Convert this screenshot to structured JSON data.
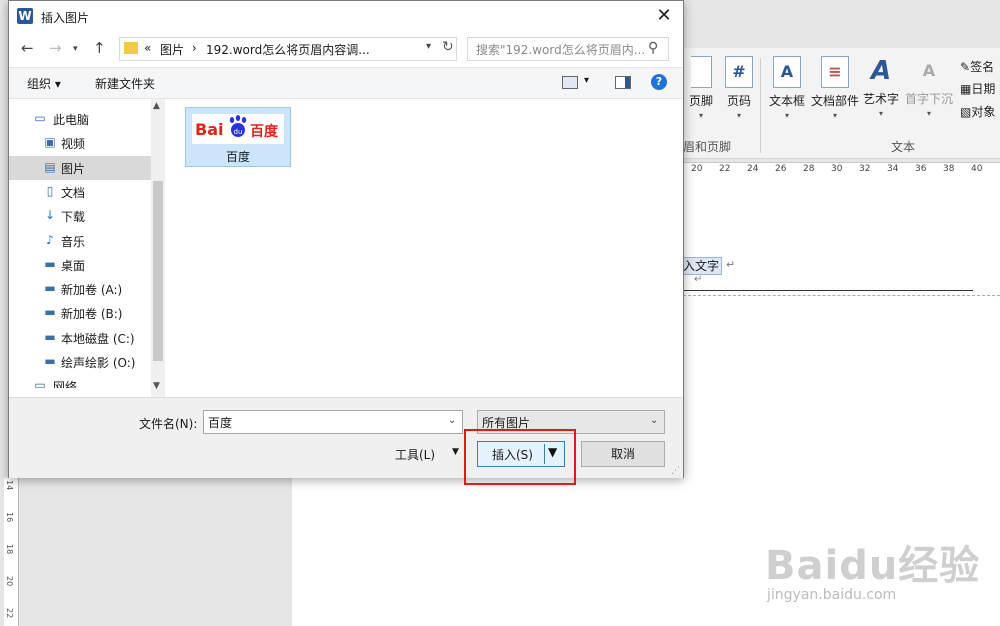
{
  "word": {
    "ribbon_buttons": [
      {
        "label": "页脚",
        "icon": "footer-icon"
      },
      {
        "label": "页码",
        "icon": "page-number-icon",
        "glyph": "#"
      },
      {
        "label": "文本框",
        "icon": "text-box-icon",
        "glyph": "A"
      },
      {
        "label": "文档部件",
        "icon": "quick-parts-icon",
        "glyph": "≡"
      },
      {
        "label": "艺术字",
        "icon": "wordart-icon",
        "glyph": "A"
      },
      {
        "label": "首字下沉",
        "icon": "drop-cap-icon",
        "glyph": "A"
      }
    ],
    "ribbon_small": [
      "签名",
      "日期",
      "对象"
    ],
    "group_header_footer": "眉和页脚",
    "group_text": "文本",
    "ruler_ticks": [
      "20",
      "22",
      "24",
      "26",
      "28",
      "30",
      "32",
      "34",
      "36",
      "38",
      "40"
    ],
    "vruler_ticks": [
      "14",
      "16",
      "18",
      "20",
      "22"
    ],
    "doc_text": "入文字",
    "pilcrow": "↵"
  },
  "dialog": {
    "title": "插入图片",
    "app_icon": "W",
    "address": {
      "prefix": "«",
      "crumb1": "图片",
      "sep": "›",
      "crumb2": "192.word怎么将页眉内容调..."
    },
    "search_placeholder": "搜索\"192.word怎么将页眉内...",
    "toolbar": {
      "organize": "组织 ▾",
      "new_folder": "新建文件夹"
    },
    "nav_items": [
      {
        "label": "此电脑",
        "icon": "computer-icon",
        "glyph": "▭",
        "indent": 1
      },
      {
        "label": "视频",
        "icon": "video-icon",
        "glyph": "▣",
        "indent": 2
      },
      {
        "label": "图片",
        "icon": "pictures-icon",
        "glyph": "▤",
        "indent": 2,
        "selected": true
      },
      {
        "label": "文档",
        "icon": "documents-icon",
        "glyph": "▯",
        "indent": 2
      },
      {
        "label": "下载",
        "icon": "downloads-icon",
        "glyph": "↓",
        "indent": 2
      },
      {
        "label": "音乐",
        "icon": "music-icon",
        "glyph": "♪",
        "indent": 2
      },
      {
        "label": "桌面",
        "icon": "desktop-icon",
        "glyph": "▬",
        "indent": 2
      },
      {
        "label": "新加卷 (A:)",
        "icon": "drive-icon",
        "glyph": "▬",
        "indent": 2
      },
      {
        "label": "新加卷 (B:)",
        "icon": "drive-icon",
        "glyph": "▬",
        "indent": 2
      },
      {
        "label": "本地磁盘 (C:)",
        "icon": "drive-c-icon",
        "glyph": "▬",
        "indent": 2
      },
      {
        "label": "绘声绘影 (O:)",
        "icon": "drive-icon",
        "glyph": "▬",
        "indent": 2
      },
      {
        "label": "网络",
        "icon": "network-icon",
        "glyph": "▭",
        "indent": 1
      }
    ],
    "file": {
      "name": "百度",
      "logo_left": "Bai",
      "logo_right": "百度"
    },
    "filename_label": "文件名(N):",
    "filename_value": "百度",
    "filter_value": "所有图片",
    "tools_label": "工具(L)",
    "insert_label": "插入(S)",
    "cancel_label": "取消"
  },
  "watermark": {
    "big": "Baidu经验",
    "small": "jingyan.baidu.com"
  },
  "colors": {
    "accent": "#2b579a",
    "highlight": "#e0191f",
    "selection": "#cde5fa",
    "baidu_red": "#e2231a",
    "baidu_blue": "#2932e1"
  }
}
